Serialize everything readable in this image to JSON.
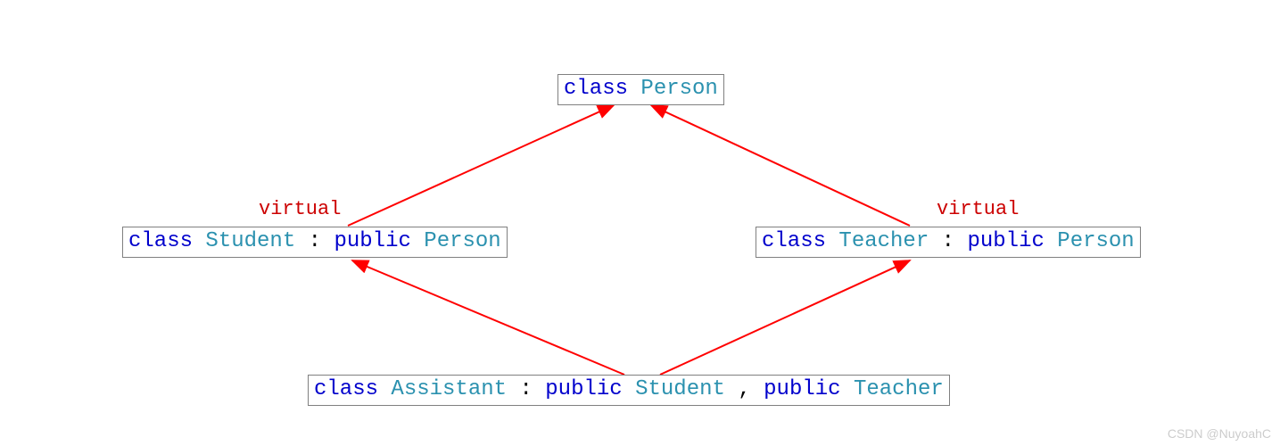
{
  "diagram": {
    "person": {
      "kw_class": "class",
      "name": "Person"
    },
    "student": {
      "kw_class": "class",
      "name": "Student",
      "sep": " : ",
      "kw_pub": "public",
      "base": "Person"
    },
    "teacher": {
      "kw_class": "class",
      "name": "Teacher",
      "sep": " : ",
      "kw_pub": "public",
      "base": "Person"
    },
    "assistant": {
      "kw_class": "class",
      "name": "Assistant",
      "sep": " : ",
      "kw_pub1": "public",
      "base1": "Student",
      "comma": ", ",
      "kw_pub2": "public",
      "base2": "Teacher"
    },
    "labels": {
      "virtual_left": "virtual",
      "virtual_right": "virtual"
    },
    "watermark": "CSDN @NuyoahC",
    "colors": {
      "arrow": "#ff0000",
      "virtual_text": "#cc0000",
      "keyword": "#0000cc",
      "typename": "#2b91af",
      "border": "#808080"
    }
  },
  "chart_data": {
    "type": "diagram",
    "nodes": [
      {
        "id": "Person",
        "declaration": "class Person"
      },
      {
        "id": "Student",
        "declaration": "class Student : public Person",
        "annotation": "virtual"
      },
      {
        "id": "Teacher",
        "declaration": "class Teacher : public Person",
        "annotation": "virtual"
      },
      {
        "id": "Assistant",
        "declaration": "class Assistant : public Student, public Teacher"
      }
    ],
    "edges": [
      {
        "from": "Student",
        "to": "Person",
        "relation": "inherits"
      },
      {
        "from": "Teacher",
        "to": "Person",
        "relation": "inherits"
      },
      {
        "from": "Assistant",
        "to": "Student",
        "relation": "inherits"
      },
      {
        "from": "Assistant",
        "to": "Teacher",
        "relation": "inherits"
      }
    ]
  }
}
